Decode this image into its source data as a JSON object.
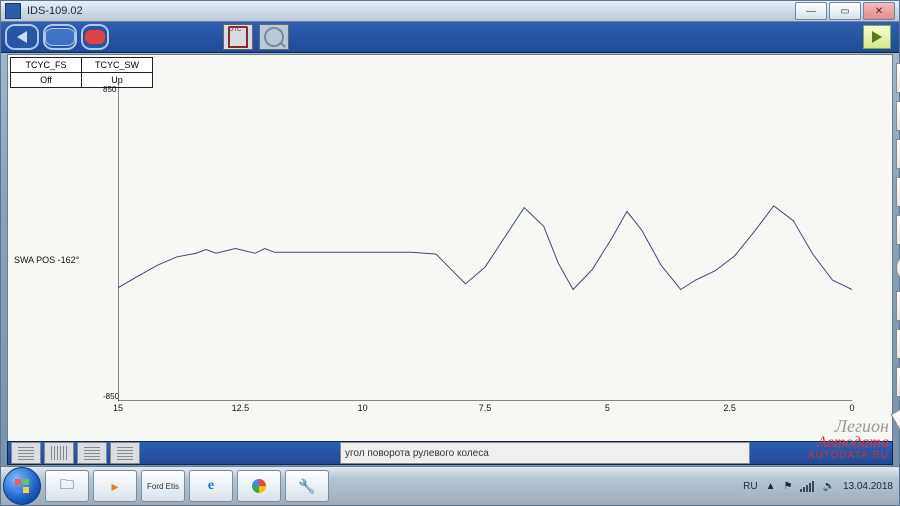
{
  "window": {
    "title": "IDS-109.02",
    "min": "—",
    "max": "▭",
    "close": "✕"
  },
  "params": [
    {
      "name": "TCYC_FS",
      "value": "Off"
    },
    {
      "name": "TCYC_SW",
      "value": "Up"
    }
  ],
  "chart_data": {
    "type": "line",
    "title": "",
    "ylabel": "SWA POS   -162°",
    "xlabel": "",
    "ylim": [
      -850,
      850
    ],
    "xlim": [
      15,
      0
    ],
    "yticks": [
      850,
      -850
    ],
    "xticks": [
      15,
      12.5,
      10,
      7.5,
      5,
      2.5,
      0
    ],
    "series": [
      {
        "name": "SWA POS",
        "x": [
          15,
          14.6,
          14.2,
          13.8,
          13.4,
          13.2,
          13.0,
          12.6,
          12.2,
          12.0,
          11.8,
          11.5,
          11.2,
          10.9,
          10.5,
          10.0,
          9.5,
          9.0,
          8.5,
          8.2,
          7.9,
          7.5,
          7.1,
          6.7,
          6.3,
          6.0,
          5.7,
          5.3,
          4.9,
          4.6,
          4.3,
          3.9,
          3.5,
          3.2,
          2.8,
          2.4,
          2.0,
          1.6,
          1.2,
          0.8,
          0.4,
          0.0
        ],
        "values": [
          -240,
          -180,
          -120,
          -75,
          -55,
          -35,
          -55,
          -30,
          -55,
          -30,
          -50,
          -50,
          -50,
          -50,
          -50,
          -50,
          -50,
          -50,
          -60,
          -140,
          -220,
          -130,
          30,
          190,
          90,
          -110,
          -250,
          -140,
          30,
          170,
          70,
          -120,
          -250,
          -200,
          -150,
          -70,
          60,
          200,
          120,
          -60,
          -200,
          -250
        ]
      }
    ]
  },
  "description_bar": "угол поворота рулевого колеса",
  "side_tools": [
    "list",
    "camera",
    "hash",
    "fingers",
    "book",
    "clock",
    "info",
    "osc-expand",
    "osc-shrink",
    "pencil"
  ],
  "taskbar": {
    "lang": "RU",
    "time": "",
    "date": "13.04.2018"
  },
  "watermark": {
    "l1": "Легион",
    "l2": "Автодата",
    "l3": "AUTODATA.RU"
  }
}
